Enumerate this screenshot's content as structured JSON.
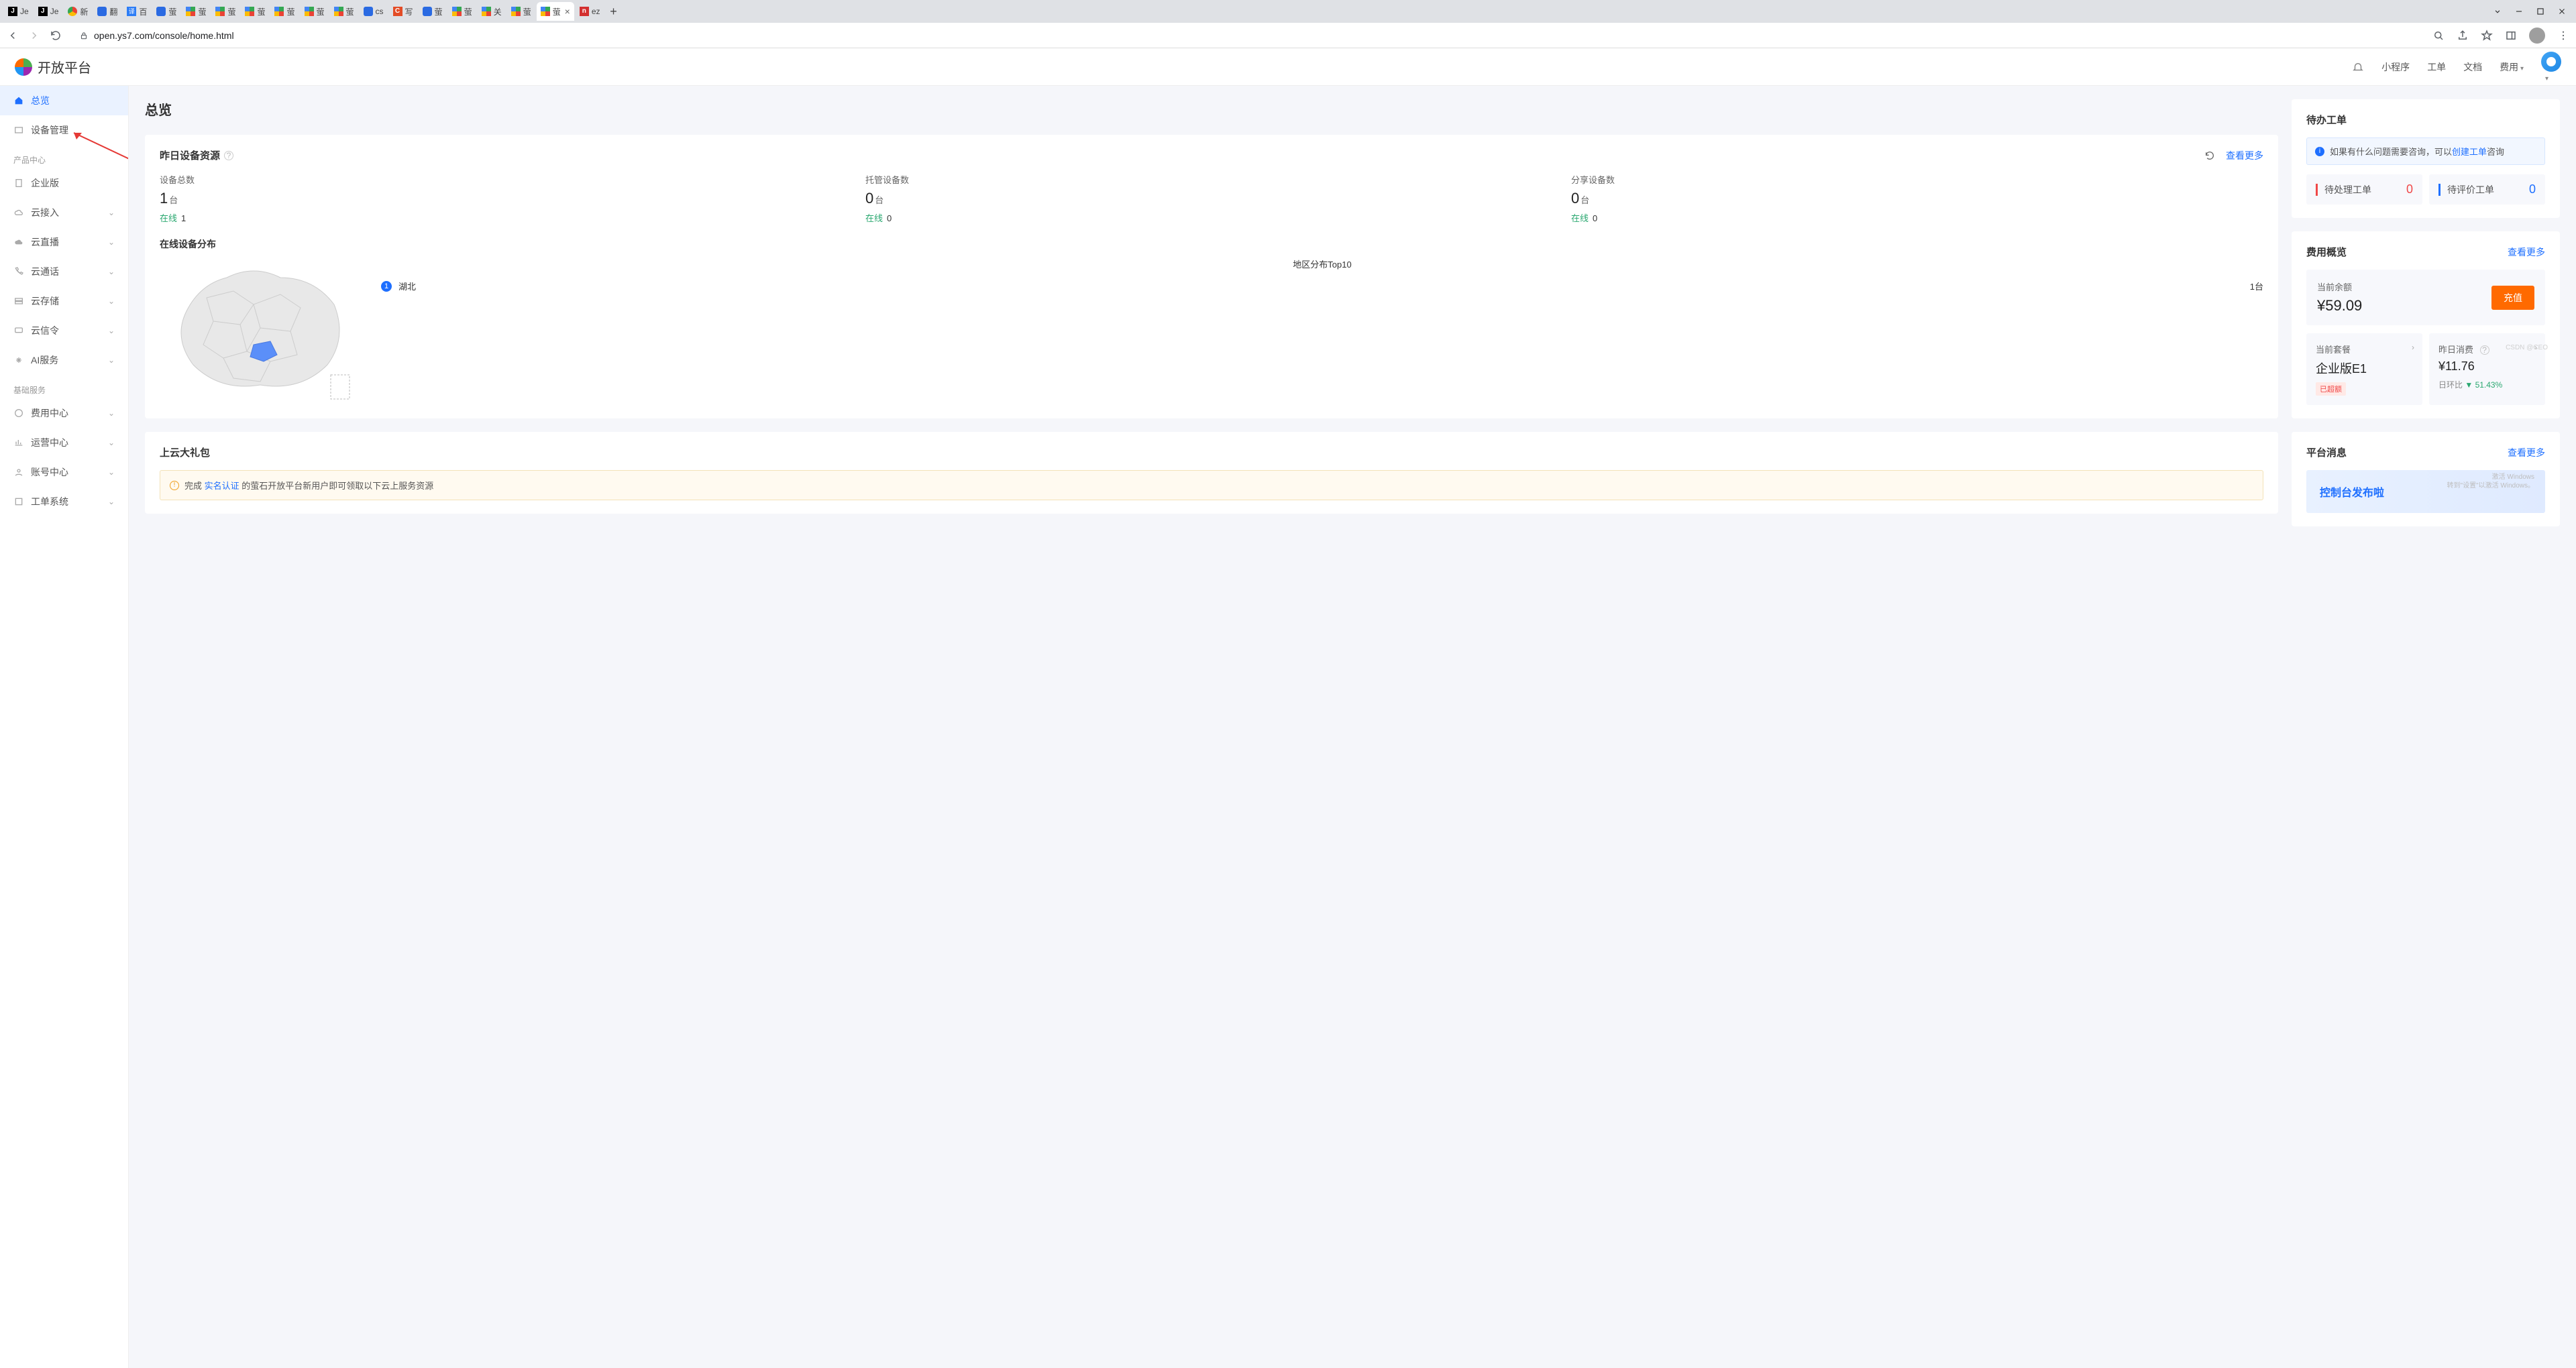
{
  "browser": {
    "tabs": [
      {
        "label": "Je"
      },
      {
        "label": "Je"
      },
      {
        "label": "新"
      },
      {
        "label": "翻"
      },
      {
        "label": "百"
      },
      {
        "label": "萤"
      },
      {
        "label": "萤"
      },
      {
        "label": "萤"
      },
      {
        "label": "萤"
      },
      {
        "label": "萤"
      },
      {
        "label": "萤"
      },
      {
        "label": "萤"
      },
      {
        "label": "cs"
      },
      {
        "label": "写"
      },
      {
        "label": "萤"
      },
      {
        "label": "萤"
      },
      {
        "label": "关"
      },
      {
        "label": "萤"
      },
      {
        "label": "萤"
      },
      {
        "label": "ez"
      }
    ],
    "url": "open.ys7.com/console/home.html"
  },
  "header": {
    "logo": "开放平台",
    "links": {
      "mini": "小程序",
      "ticket": "工单",
      "docs": "文档",
      "fees": "费用"
    }
  },
  "sidebar": {
    "overview": "总览",
    "devices": "设备管理",
    "group_product": "产品中心",
    "enterprise": "企业版",
    "cloud_access": "云接入",
    "cloud_live": "云直播",
    "cloud_call": "云通话",
    "cloud_storage": "云存储",
    "cloud_msg": "云信令",
    "ai": "AI服务",
    "group_base": "基础服务",
    "fee_center": "费用中心",
    "ops_center": "运营中心",
    "account": "账号中心",
    "ticket_sys": "工单系统"
  },
  "page": {
    "title": "总览"
  },
  "resource": {
    "title": "昨日设备资源",
    "more": "查看更多",
    "total": {
      "label": "设备总数",
      "value": "1",
      "unit": "台",
      "online_label": "在线",
      "online_count": "1"
    },
    "managed": {
      "label": "托管设备数",
      "value": "0",
      "unit": "台",
      "online_label": "在线",
      "online_count": "0"
    },
    "shared": {
      "label": "分享设备数",
      "value": "0",
      "unit": "台",
      "online_label": "在线",
      "online_count": "0"
    },
    "map_title": "在线设备分布",
    "top_title": "地区分布Top10",
    "regions": [
      {
        "rank": "1",
        "name": "湖北",
        "count": "1台"
      }
    ]
  },
  "gift": {
    "title": "上云大礼包",
    "banner_pre": "完成 ",
    "banner_link": "实名认证",
    "banner_post": " 的萤石开放平台新用户即可领取以下云上服务资源"
  },
  "todo": {
    "title": "待办工单",
    "banner_pre": "如果有什么问题需要咨询，可以",
    "banner_link": "创建工单",
    "banner_post": "咨询",
    "pending": {
      "label": "待处理工单",
      "count": "0"
    },
    "review": {
      "label": "待评价工单",
      "count": "0"
    }
  },
  "cost": {
    "title": "费用概览",
    "more": "查看更多",
    "balance_label": "当前余额",
    "balance": "¥59.09",
    "recharge": "充值",
    "plan_label": "当前套餐",
    "plan": "企业版E1",
    "over_tag": "已超额",
    "yesterday_label": "昨日消费",
    "yesterday": "¥11.76",
    "delta_label": "日环比",
    "delta": "51.43%"
  },
  "platform": {
    "title": "平台消息",
    "more": "查看更多",
    "msg_title": "控制台发布啦"
  },
  "watermark": {
    "activate": "激活 Windows",
    "activate_sub": "转到\"设置\"以激活 Windows。",
    "csdn": "CSDN @CEO"
  }
}
